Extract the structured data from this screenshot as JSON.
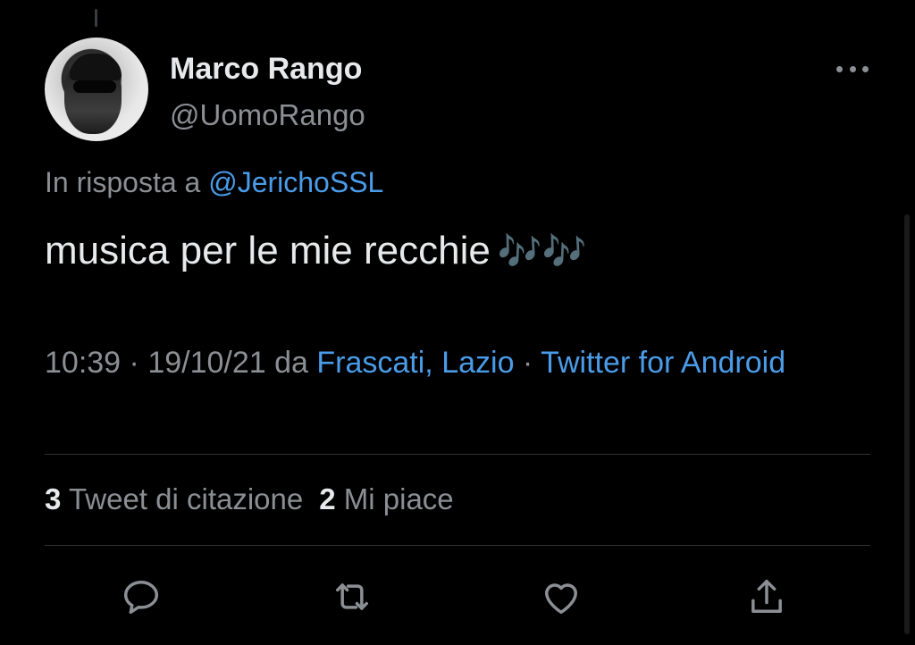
{
  "author": {
    "name": "Marco Rango",
    "handle": "@UomoRango"
  },
  "reply": {
    "prefix": "In risposta a ",
    "mention": "@JerichoSSL"
  },
  "tweet": {
    "text": "musica per le mie recchie",
    "emoji": "🎶🎶"
  },
  "meta": {
    "time": "10:39",
    "sep1": " · ",
    "date": "19/10/21",
    "da": " da ",
    "location": "Frascati, Lazio",
    "sep2": " · ",
    "source": "Twitter for Android"
  },
  "stats": {
    "quotes_count": "3",
    "quotes_label": "Tweet di citazione",
    "likes_count": "2",
    "likes_label": "Mi piace"
  },
  "actions": {
    "icons": [
      "reply-icon",
      "retweet-icon",
      "like-icon",
      "share-icon"
    ]
  },
  "colors": {
    "background": "#000000",
    "text": "#e7e9ea",
    "secondary": "#8b8f94",
    "link": "#4a9ce8",
    "divider": "#2f3336"
  }
}
